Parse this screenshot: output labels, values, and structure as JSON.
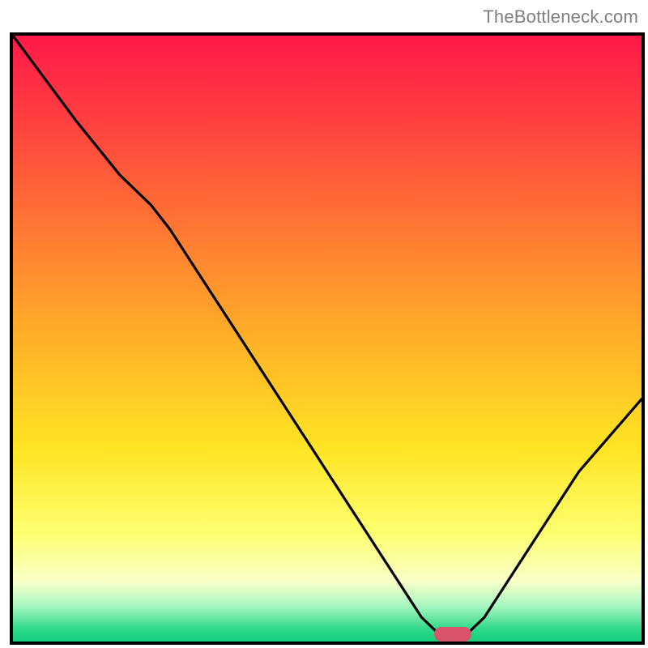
{
  "attribution": "TheBottleneck.com",
  "chart_data": {
    "type": "line",
    "title": "",
    "xlabel": "",
    "ylabel": "",
    "x": [
      0.0,
      0.05,
      0.1,
      0.17,
      0.22,
      0.25,
      0.3,
      0.35,
      0.4,
      0.45,
      0.5,
      0.55,
      0.6,
      0.65,
      0.68,
      0.72,
      0.75,
      0.8,
      0.85,
      0.9,
      0.95,
      1.0
    ],
    "values": [
      1.0,
      0.93,
      0.86,
      0.77,
      0.72,
      0.68,
      0.6,
      0.52,
      0.44,
      0.36,
      0.28,
      0.2,
      0.12,
      0.04,
      0.01,
      0.01,
      0.04,
      0.12,
      0.2,
      0.28,
      0.34,
      0.4
    ],
    "xlim": [
      0,
      1
    ],
    "ylim": [
      0,
      1
    ],
    "marker": {
      "x_center": 0.7,
      "width": 0.06
    },
    "background_gradient": {
      "top": "#ff1948",
      "mid": "#ffe423",
      "bottom": "#17d080"
    }
  }
}
